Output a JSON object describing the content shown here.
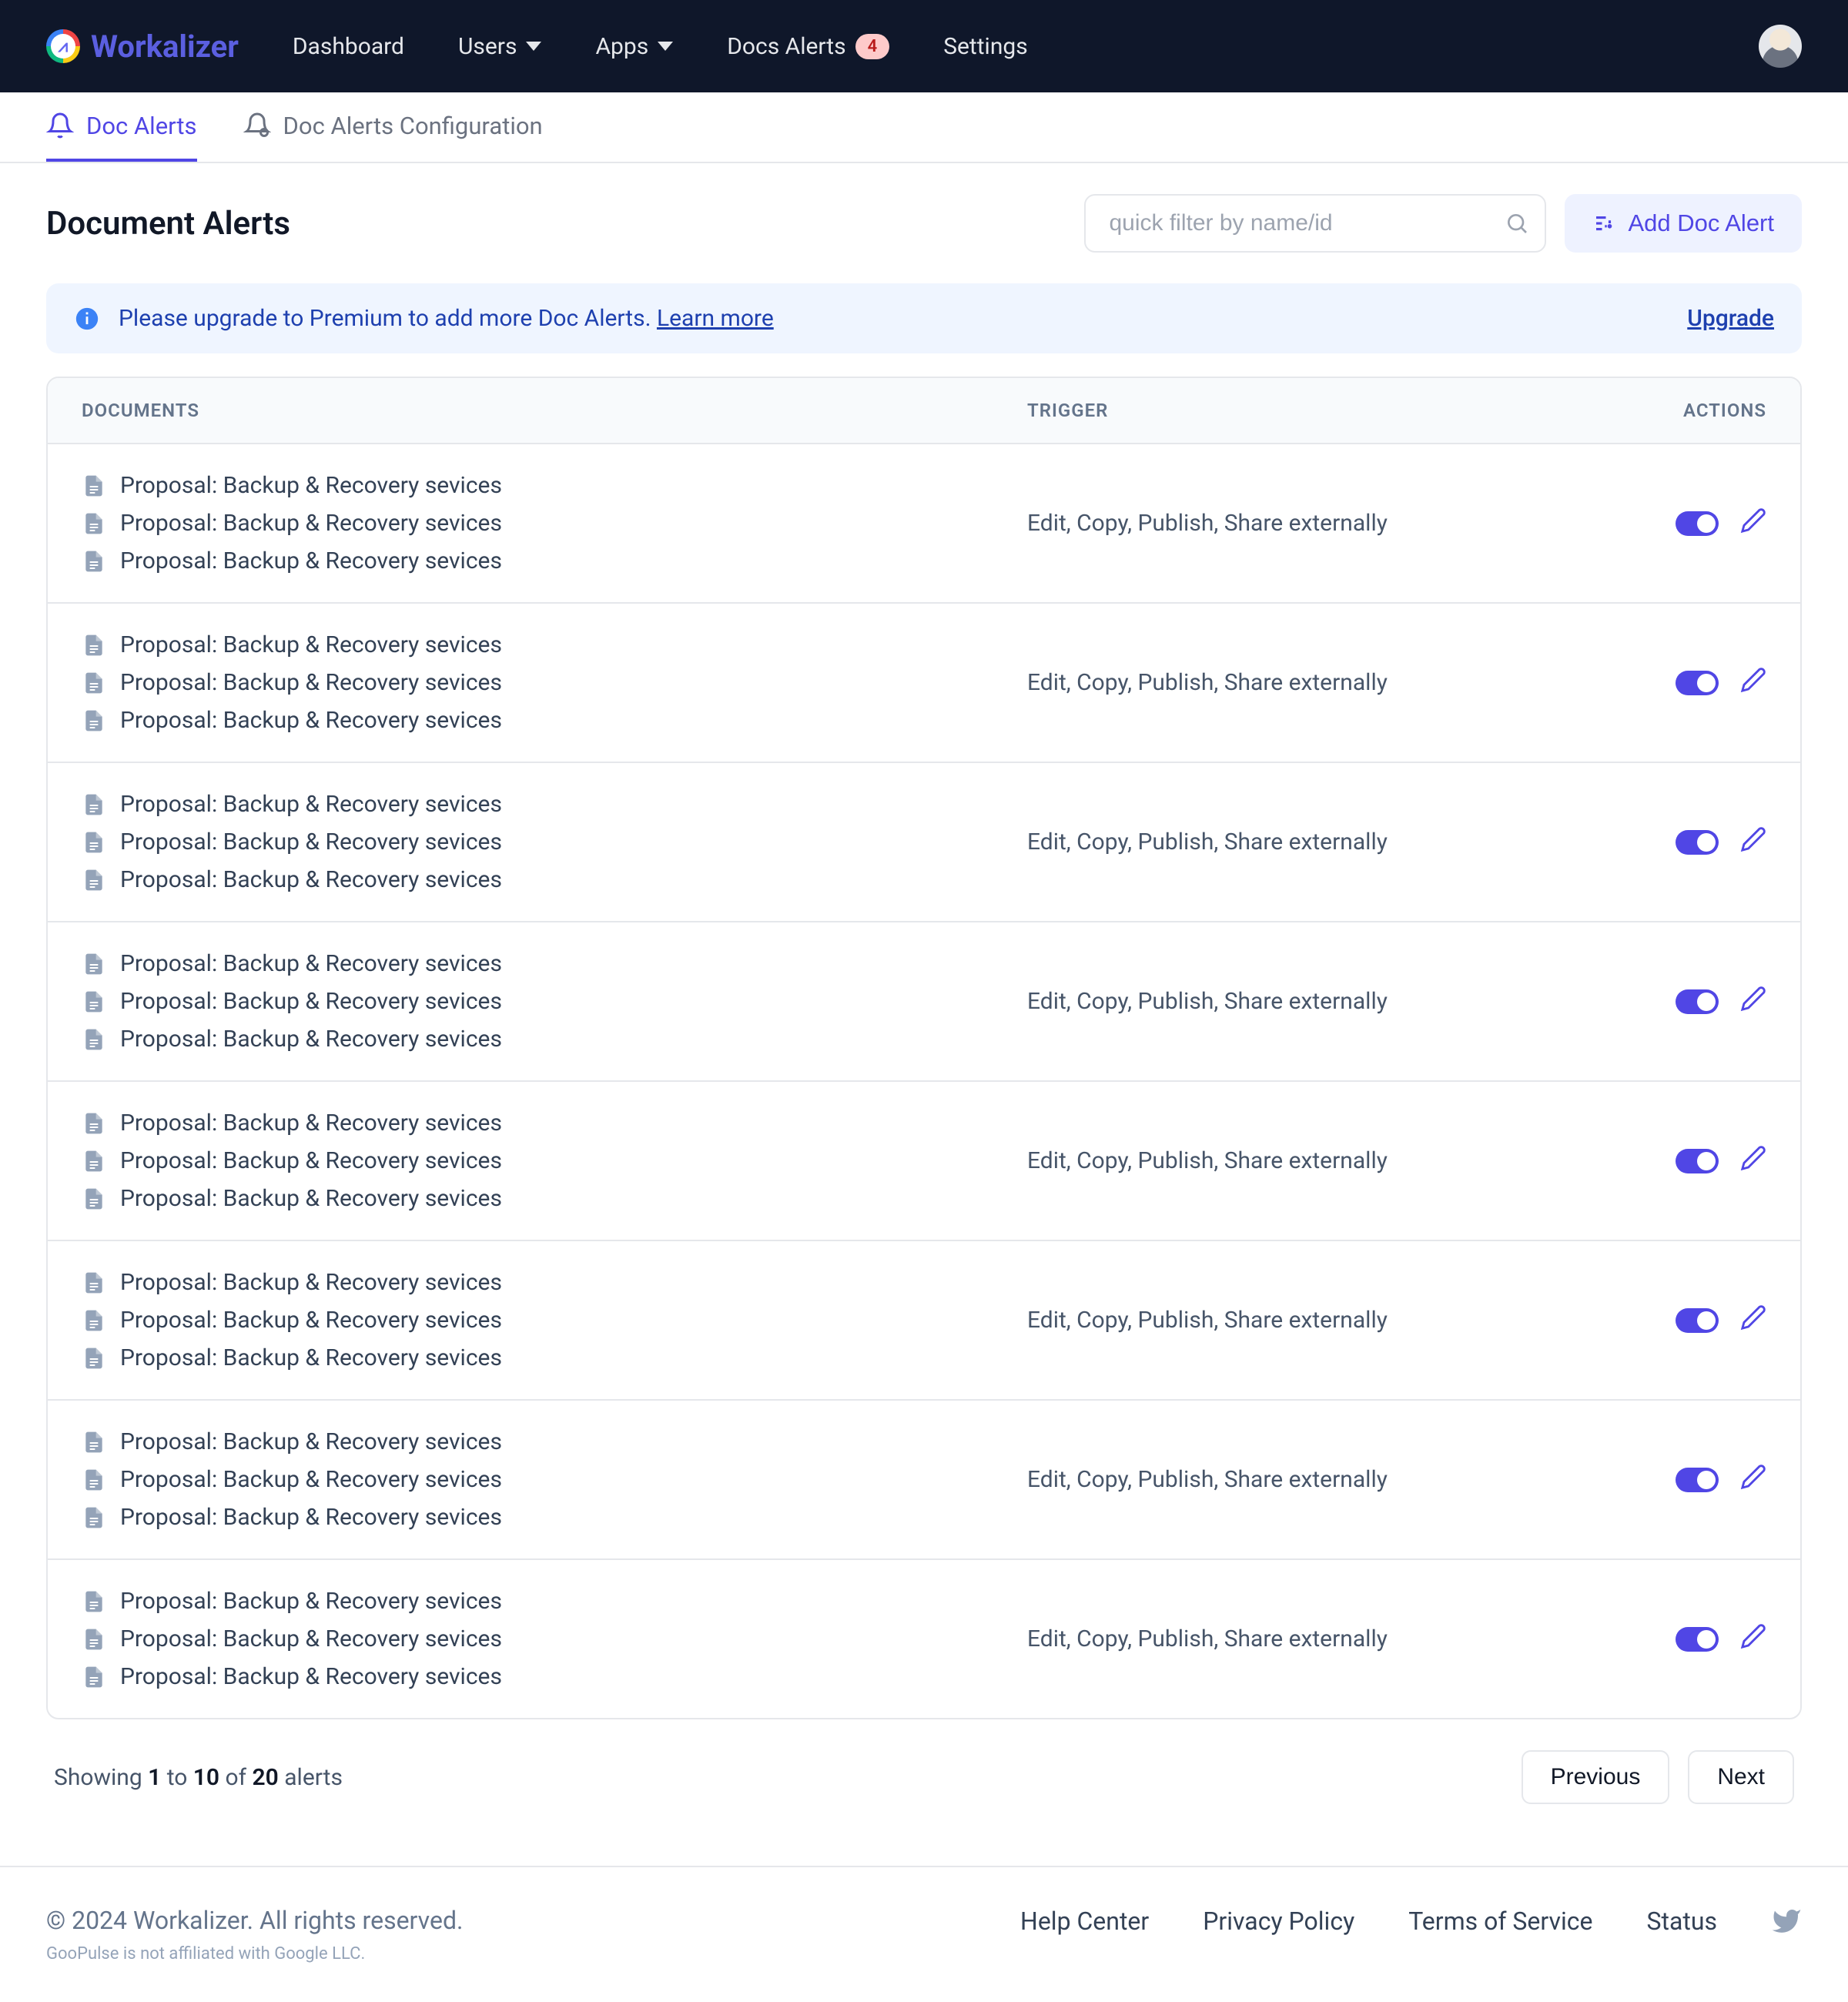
{
  "brand": "Workalizer",
  "nav": {
    "dashboard": "Dashboard",
    "users": "Users",
    "apps": "Apps",
    "docs_alerts": "Docs Alerts",
    "badge": "4",
    "settings": "Settings"
  },
  "tabs": {
    "alerts": "Doc Alerts",
    "config": "Doc Alerts Configuration"
  },
  "page": {
    "title": "Document Alerts",
    "filter_placeholder": "quick filter by name/id",
    "add_button": "Add Doc Alert"
  },
  "banner": {
    "text": "Please upgrade to Premium to add more Doc Alerts. ",
    "learn": "Learn more",
    "upgrade": "Upgrade"
  },
  "table": {
    "head_docs": "DOCUMENTS",
    "head_trigger": "TRIGGER",
    "head_actions": "ACTIONS",
    "doc_name": "Proposal: Backup & Recovery sevices",
    "trigger_text": "Edit, Copy, Publish, Share externally"
  },
  "pagination": {
    "prefix": "Showing ",
    "from": "1",
    "mid": " to ",
    "to": "10",
    "of": " of ",
    "total": "20",
    "suffix": " alerts",
    "prev": "Previous",
    "next": "Next"
  },
  "footer": {
    "copyright": "© 2024 Workalizer. All rights reserved.",
    "disclaimer": "GooPulse is not affiliated with Google LLC.",
    "help": "Help Center",
    "privacy": "Privacy Policy",
    "terms": "Terms of Service",
    "status": "Status"
  }
}
